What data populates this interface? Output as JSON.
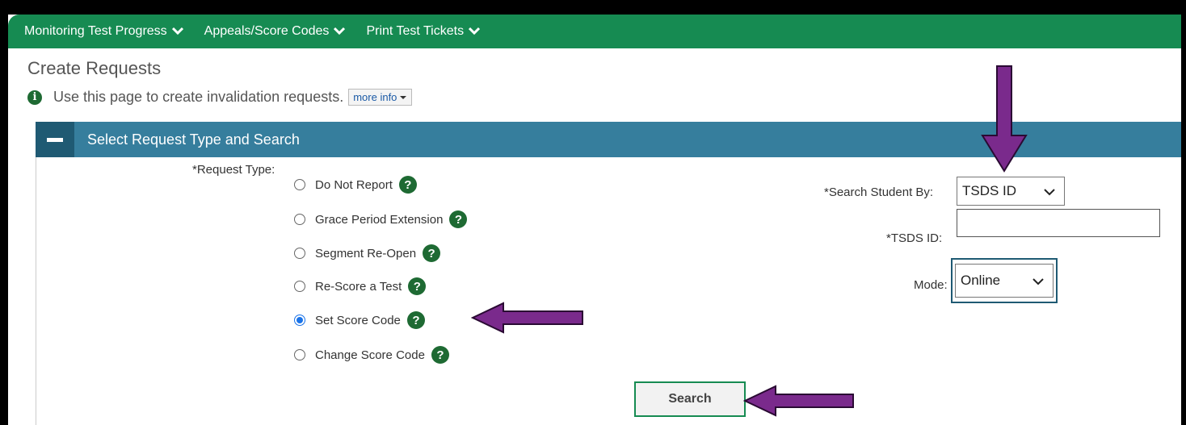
{
  "nav": {
    "items": [
      "Monitoring Test Progress",
      "Appeals/Score Codes",
      "Print Test Tickets"
    ]
  },
  "page": {
    "title": "Create Requests",
    "info_text": "Use this page to create invalidation requests.",
    "more_info": "more info"
  },
  "section": {
    "title": "Select Request Type and Search"
  },
  "request_type": {
    "label": "*Request Type:",
    "options": [
      {
        "label": "Do Not Report",
        "checked": false
      },
      {
        "label": "Grace Period Extension",
        "checked": false
      },
      {
        "label": "Segment Re-Open",
        "checked": false
      },
      {
        "label": "Re-Score a Test",
        "checked": false
      },
      {
        "label": "Set Score Code",
        "checked": true
      },
      {
        "label": "Change Score Code",
        "checked": false
      }
    ]
  },
  "search_by": {
    "label": "*Search Student By:",
    "value": "TSDS ID"
  },
  "tsds_id": {
    "label": "*TSDS ID:",
    "value": ""
  },
  "mode": {
    "label": "Mode:",
    "value": "Online"
  },
  "search_button": "Search",
  "colors": {
    "nav_green": "#168b52",
    "section_blue": "#367e9d",
    "help_green": "#1e6a33",
    "annotation_purple": "#7a2a8c"
  }
}
